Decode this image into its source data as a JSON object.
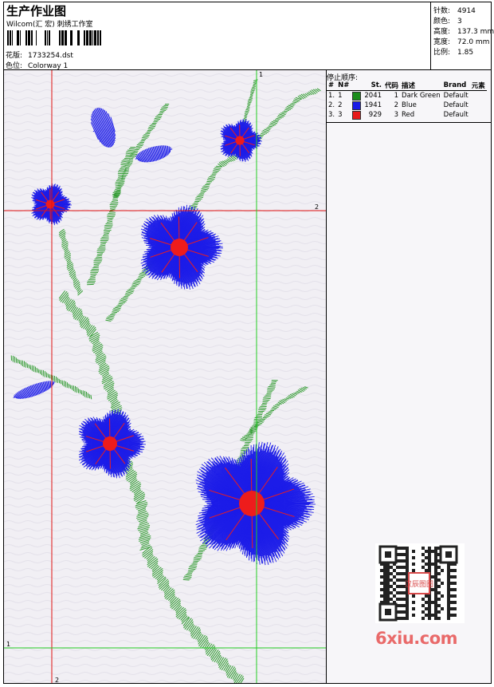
{
  "header": {
    "title": "生产作业图",
    "subtitle": "Wilcom(汇 宏) 刺绣工作室",
    "design_label": "花版:",
    "design_value": "1733254.dst",
    "colorway_label": "色位:",
    "colorway_value": "Colorway 1"
  },
  "stats": {
    "stitches_label": "针数:",
    "stitches_value": "4914",
    "colors_label": "颜色:",
    "colors_value": "3",
    "height_label": "高度:",
    "height_value": "137.3 mm",
    "width_label": "宽度:",
    "width_value": "72.0 mm",
    "scale_label": "比例:",
    "scale_value": "1.85"
  },
  "stop_sequence": {
    "heading": "停止顺序:",
    "columns": [
      "#",
      "N#",
      "St.",
      "代码",
      "描述",
      "Brand",
      "元素"
    ],
    "rows": [
      {
        "idx": "1.",
        "n": "1",
        "color": "#1b8c1b",
        "st": "2041",
        "code": "1",
        "desc": "Dark Green",
        "brand": "Default"
      },
      {
        "idx": "2.",
        "n": "2",
        "color": "#1a1ae6",
        "st": "1941",
        "code": "2",
        "desc": "Blue",
        "brand": "Default"
      },
      {
        "idx": "3.",
        "n": "3",
        "color": "#e61a1a",
        "st": "929",
        "code": "3",
        "desc": "Red",
        "brand": "Default"
      }
    ]
  },
  "guides": {
    "top_label": "1",
    "right_label": "2",
    "left_label": "1",
    "bottom_label": "2"
  },
  "colors": {
    "stem": "#2d9a2d",
    "petal": "#1c1ce8",
    "center": "#ee1c1c",
    "guide_red": "#e01010",
    "guide_green": "#22cc22"
  },
  "watermark": {
    "text": "6xiu.com",
    "seal": "汉辰图图"
  }
}
